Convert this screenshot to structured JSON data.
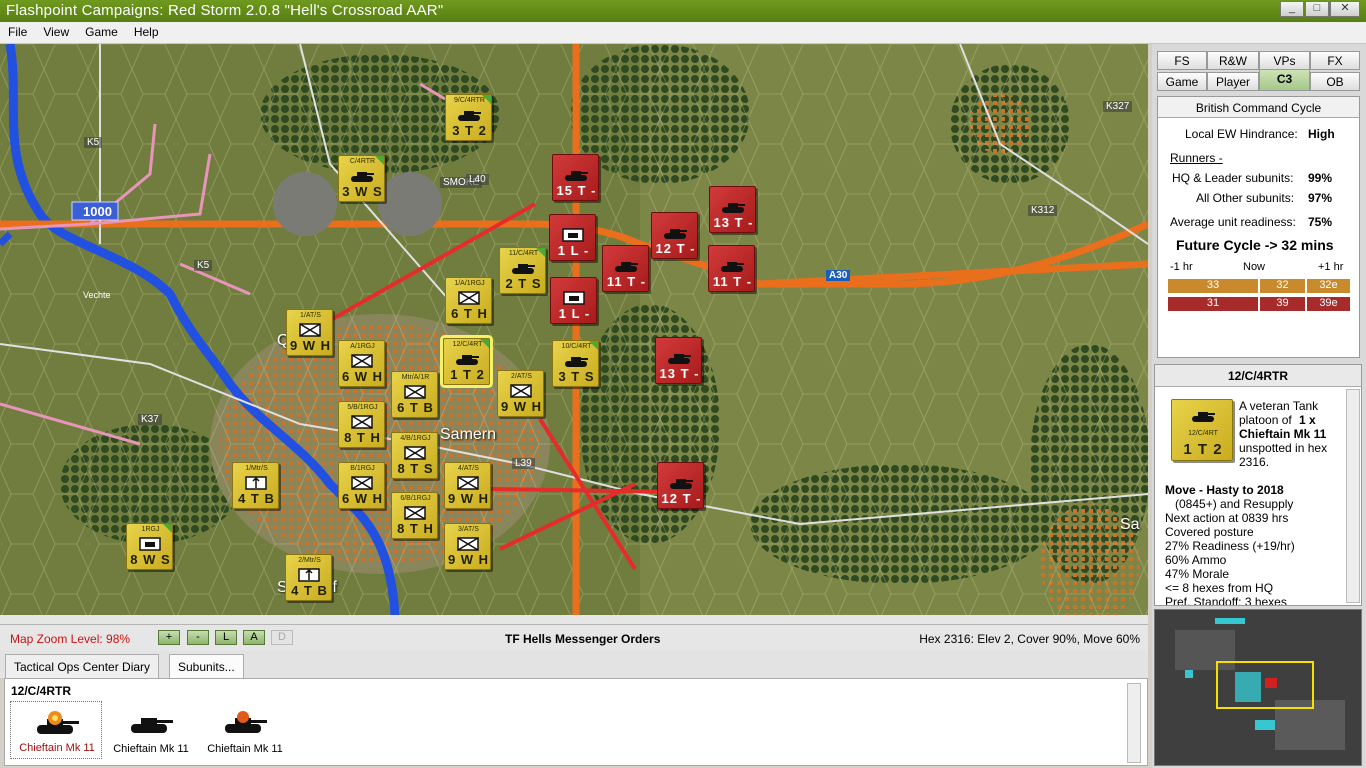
{
  "window": {
    "title": "Flashpoint Campaigns: Red Storm  2.0.8  \"Hell's Crossroad AAR\"",
    "controls": [
      "_",
      "□",
      "✕"
    ]
  },
  "menu": [
    "File",
    "View",
    "Game",
    "Help"
  ],
  "map": {
    "road_labels": [
      "K5",
      "K5",
      "L40",
      "K37",
      "L39",
      "K312",
      "K327",
      "A30"
    ],
    "town_labels": [
      "Samern",
      "Sa",
      "Q",
      "S",
      "rf"
    ],
    "river_label": "Vechte",
    "distance_marker": "1000",
    "smoke_label": "SMOKE",
    "nato_units": [
      {
        "id": "9/C/4RTR",
        "stat": "3 T 2"
      },
      {
        "id": "C/4RTR",
        "stat": "3 W S"
      },
      {
        "id": "11/C/4RT",
        "stat": "2 T S"
      },
      {
        "id": "1/A/1RGJ",
        "stat": "6 T H"
      },
      {
        "id": "1/AT/S",
        "stat": "9 W H"
      },
      {
        "id": "A/1RGJ",
        "stat": "6 W H"
      },
      {
        "id": "12/C/4RT",
        "stat": "1 T 2"
      },
      {
        "id": "10/C/4RT",
        "stat": "3 T S"
      },
      {
        "id": "Mtr/A/1R",
        "stat": "6 T B"
      },
      {
        "id": "2/AT/S",
        "stat": "9 W H"
      },
      {
        "id": "5/B/1RGJ",
        "stat": "8 T H"
      },
      {
        "id": "4/B/1RGJ",
        "stat": "8 T S"
      },
      {
        "id": "1/Mtr/S",
        "stat": "4 T B"
      },
      {
        "id": "B/1RGJ",
        "stat": "6 W H"
      },
      {
        "id": "4/AT/S",
        "stat": "9 W H"
      },
      {
        "id": "6/B/1RGJ",
        "stat": "8 T H"
      },
      {
        "id": "1RGJ",
        "stat": "8 W S"
      },
      {
        "id": "3/AT/S",
        "stat": "9 W H"
      },
      {
        "id": "2/Mtr/S",
        "stat": "4 T B"
      }
    ],
    "warpac_units": [
      {
        "stat": "15 T -"
      },
      {
        "stat": "1 L -"
      },
      {
        "stat": "12 T -"
      },
      {
        "stat": "13 T -"
      },
      {
        "stat": "11 T -"
      },
      {
        "stat": "11 T -"
      },
      {
        "stat": "1 L -"
      },
      {
        "stat": "13 T -"
      },
      {
        "stat": "12 T -"
      }
    ]
  },
  "status": {
    "zoom": "Map Zoom Level: 98%",
    "zoom_buttons": [
      "+",
      "-",
      "L",
      "A",
      "D"
    ],
    "orders_title": "TF Hells Messenger Orders",
    "hex_info": "Hex 2316: Elev 2, Cover 90%, Move 60%"
  },
  "bottom_tabs": [
    "Tactical Ops Center Diary",
    "Subunits..."
  ],
  "subunits": {
    "header": "12/C/4RTR",
    "items": [
      {
        "label": "Chieftain Mk 11",
        "state": "destroyed",
        "color": "#a01010"
      },
      {
        "label": "Chieftain Mk 11",
        "state": "ok",
        "color": "#000000"
      },
      {
        "label": "Chieftain Mk 11",
        "state": "damaged",
        "color": "#000000"
      }
    ]
  },
  "right_tabs": {
    "row1": [
      "FS",
      "R&W",
      "VPs",
      "FX"
    ],
    "row2": [
      "Game",
      "Player",
      "C3",
      "OB"
    ]
  },
  "c3": {
    "title": "British Command Cycle",
    "ew_label": "Local EW Hindrance:",
    "ew_value": "High",
    "runners_label": "Runners -",
    "hq_label": "HQ & Leader subunits:",
    "hq_value": "99%",
    "other_label": "All Other subunits:",
    "other_value": "97%",
    "readiness_label": "Average unit readiness:",
    "readiness_value": "75%",
    "future_cycle": "Future Cycle -> 32 mins",
    "timeline": [
      "-1 hr",
      "Now",
      "+1 hr"
    ],
    "row_orange": [
      "33",
      "32",
      "32e"
    ],
    "row_red": [
      "31",
      "39",
      "39e"
    ]
  },
  "unit_info": {
    "title": "12/C/4RTR",
    "counter_id": "12/C/4RT",
    "counter_stat": "1 T 2",
    "desc_1": "A veteran Tank",
    "desc_2": "platoon of",
    "desc_3": "1 x",
    "desc_4": "Chieftain Mk 11",
    "desc_5": "unspotted in hex",
    "desc_6": "2316.",
    "bullets": [
      "Move - Hasty to 2018",
      "(0845+) and Resupply",
      "Next action at 0839 hrs",
      "Covered posture",
      "27% Readiness (+19/hr)",
      "60% Ammo",
      "47% Morale",
      "<= 8 hexes from HQ",
      "Pref. Standoff: 3 hexes"
    ]
  },
  "colors": {
    "nato": "#d6bf33",
    "warpac": "#c02727",
    "titlebar": "#5f8a17",
    "road": "#e9701e",
    "river": "#1f4fe0"
  }
}
